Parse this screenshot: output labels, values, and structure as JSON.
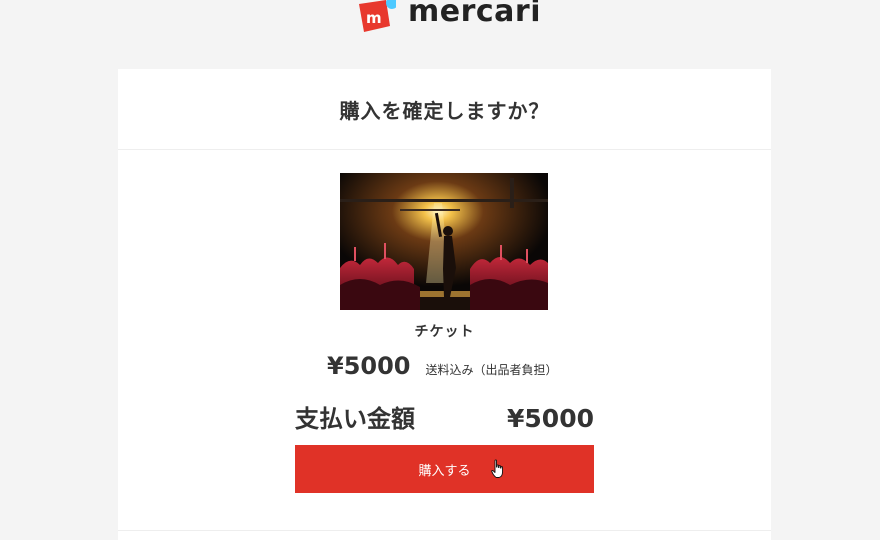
{
  "logo": {
    "text": "mercari",
    "brand_red": "#e8382d",
    "brand_blue": "#4dc9ff"
  },
  "dialog": {
    "title": "購入を確定しますか？"
  },
  "product": {
    "image_icon": "concert-photo",
    "name": "チケット",
    "price": "¥5000",
    "shipping_note": "送料込み（出品者負担）"
  },
  "payment": {
    "total_label": "支払い金額",
    "total_value": "¥5000"
  },
  "actions": {
    "purchase_label": "購入する",
    "purchase_color": "#e03227"
  },
  "cursor": {
    "icon": "hand-pointer-icon"
  }
}
